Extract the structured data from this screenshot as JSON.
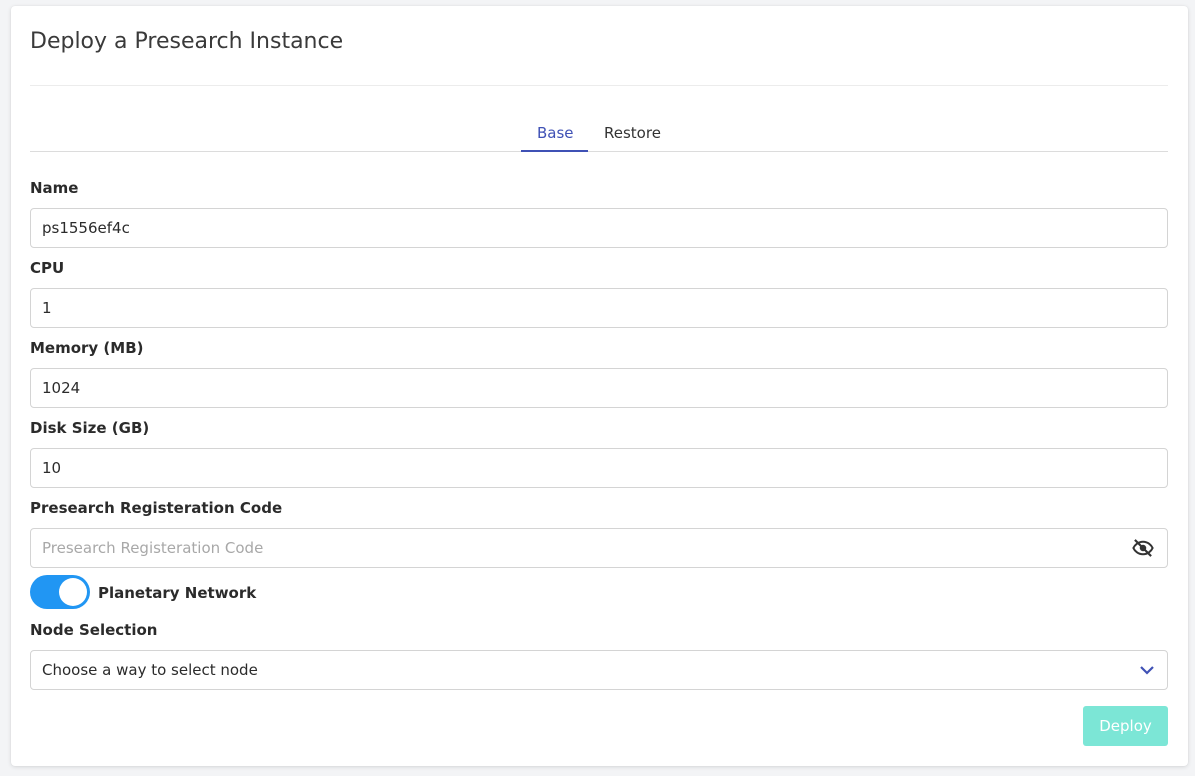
{
  "page": {
    "title": "Deploy a Presearch Instance"
  },
  "tabs": [
    {
      "label": "Base",
      "active": true
    },
    {
      "label": "Restore",
      "active": false
    }
  ],
  "form": {
    "name": {
      "label": "Name",
      "value": "ps1556ef4c"
    },
    "cpu": {
      "label": "CPU",
      "value": "1"
    },
    "memory": {
      "label": "Memory (MB)",
      "value": "1024"
    },
    "disk": {
      "label": "Disk Size (GB)",
      "value": "10"
    },
    "code": {
      "label": "Presearch Registeration Code",
      "value": "",
      "placeholder": "Presearch Registeration Code",
      "icon": "eye-off-icon"
    },
    "planetary": {
      "label": "Planetary Network",
      "enabled": true
    },
    "node_selection": {
      "label": "Node Selection",
      "value": "Choose a way to select node",
      "icon": "chevron-down-icon"
    }
  },
  "actions": {
    "deploy_label": "Deploy"
  },
  "colors": {
    "accent": "#3f51b5",
    "toggle": "#2196f3",
    "deploy_button": "#7ce6d6"
  }
}
